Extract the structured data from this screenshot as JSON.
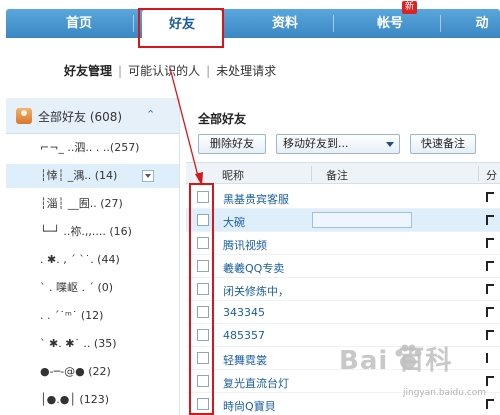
{
  "nav": {
    "items": [
      "首页",
      "好友",
      "资料",
      "帐号",
      "动"
    ],
    "new_badge": "新"
  },
  "subtabs": {
    "current": "好友管理",
    "sep": "|",
    "maybe_know": "可能认识的人",
    "pending": "未处理请求"
  },
  "sidebar": {
    "all_friends": "全部好友 (608)",
    "chevron": "⌃",
    "groups": [
      "⌐¬_ ..泗.. . ..(257)",
      "┆悻┆ _湡.. (14)",
      "┆淄┆ __囿.. (27)",
      "└─┘ ..祢.,,.... (16)",
      ". ✱. ,  ´ ˋ˙. (44)",
      "ˋ . 喋岖 . ˊ (0)",
      ". . ˊ˙ᵐ˙ (12)",
      "ˋ ✱. ✱˙ .. (35)",
      "●-─-@● (22)",
      "│●.●│ (123)"
    ]
  },
  "main": {
    "title": "全部好友",
    "delete_btn": "删除好友",
    "move_btn": "移动好友到...",
    "quick_note_btn": "快速备注",
    "col_nick": "昵称",
    "col_note": "备注",
    "col_group": "分",
    "rows": [
      "黑基贵宾客服",
      "大碗",
      "腾讯视频",
      "羲羲QQ专卖",
      "闭关修炼中，",
      "343345",
      "485357",
      "轻舞霓裳",
      "复光直流台灯",
      "時尙Q寶貝"
    ]
  },
  "watermark": {
    "brand": "Bai  百科",
    "url": "jingyan.baidu.com"
  },
  "colors": {
    "nav_blue": "#3a87c4",
    "annotation_red": "#d6161b",
    "link_blue": "#1b5fa3"
  }
}
